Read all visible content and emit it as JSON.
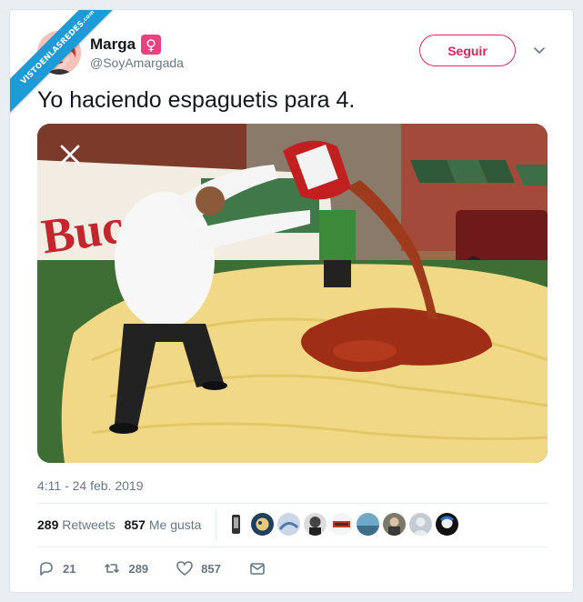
{
  "watermark": {
    "text": "VISTOENLASREDES",
    "suffix": ".com"
  },
  "author": {
    "name": "Marga",
    "badge_symbol": "♀",
    "handle": "@SoyAmargada"
  },
  "follow_label": "Seguir",
  "tweet": {
    "text": "Yo haciendo espaguetis para 4.",
    "timestamp": "4:11 - 24 feb. 2019"
  },
  "stats": {
    "retweets_count": "289",
    "retweets_label": "Retweets",
    "likes_count": "857",
    "likes_label": "Me gusta"
  },
  "likers": [
    "liker-1",
    "liker-2",
    "liker-3",
    "liker-4",
    "liker-5",
    "liker-6",
    "liker-7",
    "liker-8",
    "liker-9"
  ],
  "actions": {
    "replies": "21",
    "retweets": "289",
    "likes": "857"
  },
  "colors": {
    "accent_pink": "#e0245e",
    "badge_pink": "#e8437e",
    "ribbon_blue": "#1d9bd7",
    "muted": "#657786"
  },
  "icons": [
    "close-icon",
    "chevron-down-icon",
    "reply-icon",
    "retweet-icon",
    "heart-icon",
    "mail-icon"
  ]
}
